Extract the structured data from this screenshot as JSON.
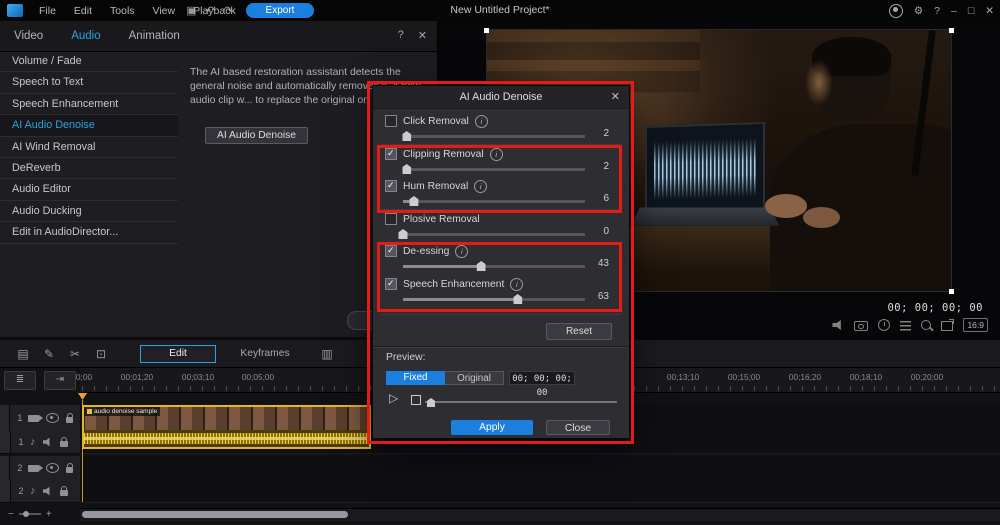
{
  "menubar": {
    "menus": [
      "File",
      "Edit",
      "Tools",
      "View",
      "Playback"
    ],
    "export_label": "Export",
    "project_title": "New Untitled Project*"
  },
  "icons": {
    "grid": "▣",
    "undo": "↶",
    "redo": "↷",
    "gear": "⚙",
    "help": "?",
    "minimize": "–",
    "maximize": "□",
    "close": "✕",
    "panel_help": "?",
    "panel_close": "✕",
    "dialog_close": "✕",
    "info": "i",
    "play": "▷",
    "select_tool": "▤",
    "pen_tool": "✎",
    "scissors_tool": "✂",
    "crop_tool": "⊡",
    "panel_toggle": "▥",
    "track_list": "≣",
    "snap": "⇥",
    "note": "♪",
    "zoom_out": "−",
    "zoom_in": "+"
  },
  "panel": {
    "tabs": [
      "Video",
      "Audio",
      "Animation"
    ],
    "active_tab": "Audio",
    "items": [
      "Volume / Fade",
      "Speech to Text",
      "Speech Enhancement",
      "AI Audio Denoise",
      "AI Wind Removal",
      "DeReverb",
      "Audio Editor",
      "Audio Ducking",
      "Edit in AudioDirector..."
    ],
    "active_item_index": 3,
    "description": "The AI based restoration assistant detects the general noise and automatically removes it. A new audio clip w... to replace the original on the timeline.",
    "denoise_button": "AI Audio Denoise"
  },
  "preview": {
    "timecode": "00; 00; 00; 00",
    "aspect_ratio": "16:9"
  },
  "dialog": {
    "title": "AI Audio Denoise",
    "controls": [
      {
        "label": "Click Removal",
        "checked": false,
        "value": 2,
        "info": true
      },
      {
        "label": "Clipping Removal",
        "checked": true,
        "value": 2,
        "info": true
      },
      {
        "label": "Hum Removal",
        "checked": true,
        "value": 6,
        "info": true
      },
      {
        "label": "Plosive Removal",
        "checked": false,
        "value": 0,
        "info": false
      },
      {
        "label": "De-essing",
        "checked": true,
        "value": 43,
        "info": true
      },
      {
        "label": "Speech Enhancement",
        "checked": true,
        "value": 63,
        "info": true
      }
    ],
    "reset_label": "Reset",
    "preview_label": "Preview:",
    "mode_fixed": "Fixed",
    "mode_original": "Original",
    "preview_timecode": "00; 00; 00; 00",
    "apply_label": "Apply",
    "close_label": "Close"
  },
  "timeline": {
    "edit_tab": "Edit",
    "keyframes_tab": "Keyframes",
    "ruler": [
      "0;00",
      "00;01;20",
      "00;03;10",
      "00;05;00",
      "00;13;10",
      "00;15;00",
      "00;16;20",
      "00;18;10",
      "00;20;00"
    ],
    "clip_label": "audio denoise sample",
    "tracks": [
      {
        "number": "1",
        "kind": "video"
      },
      {
        "number": "1",
        "kind": "audio"
      },
      {
        "number": "2",
        "kind": "video"
      },
      {
        "number": "2",
        "kind": "audio"
      }
    ]
  },
  "colors": {
    "accent_blue": "#1b7fe0",
    "active_text_blue": "#2aa3e0",
    "annotation_red": "#e41b17",
    "clip_yellow": "#e8b428"
  }
}
